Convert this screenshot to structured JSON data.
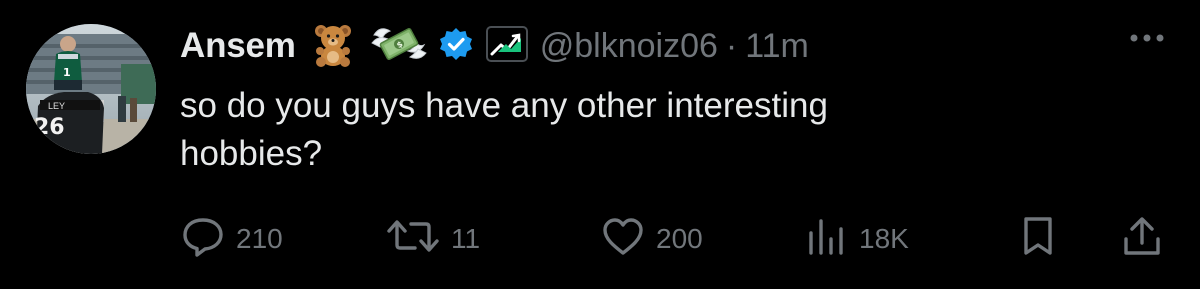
{
  "tweet": {
    "display_name": "Ansem",
    "handle": "@blknoiz06",
    "separator": "·",
    "time": "11m",
    "text": "so do you guys have any other interesting\nhobbies?",
    "emojis": [
      "teddy-bear-emoji",
      "money-with-wings-emoji"
    ],
    "avatar": {
      "jersey_number": "26",
      "shirt_number": "1"
    }
  },
  "actions": {
    "replies": "210",
    "reposts": "11",
    "likes": "200",
    "views": "18K"
  },
  "colors": {
    "background": "#000000",
    "primary_text": "#e7e9ea",
    "secondary_text": "#71767b",
    "verified_blue": "#1d9bf0"
  }
}
